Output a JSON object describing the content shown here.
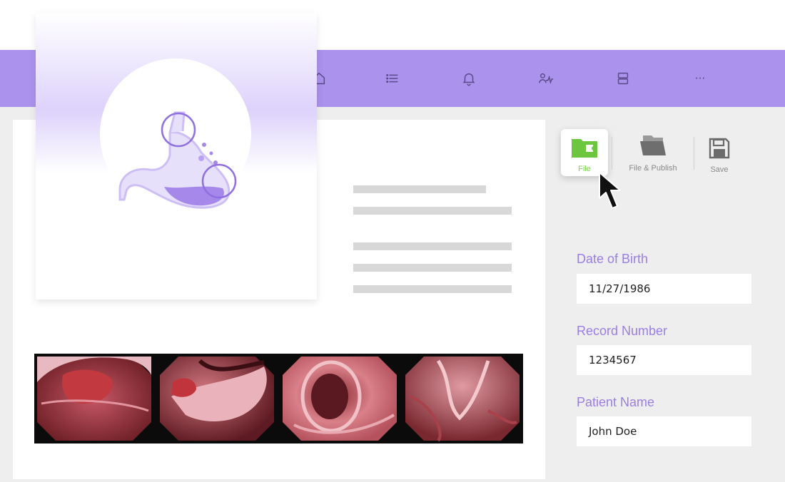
{
  "nav": {
    "icons": [
      "home-icon",
      "list-icon",
      "bell-icon",
      "users-activity-icon",
      "server-icon",
      "more-icon"
    ],
    "more_glyph": "···"
  },
  "toolbar": {
    "file_label": "File",
    "file_publish_label": "File & Publish",
    "save_label": "Save"
  },
  "form": {
    "dob_label": "Date of Birth",
    "dob_value": "11/27/1986",
    "record_label": "Record Number",
    "record_value": "1234567",
    "patient_label": "Patient Name",
    "patient_value": "John Doe"
  },
  "colors": {
    "brand_purple": "#ab92ec",
    "label_purple": "#9a7ee6",
    "file_green": "#7bd04f"
  }
}
